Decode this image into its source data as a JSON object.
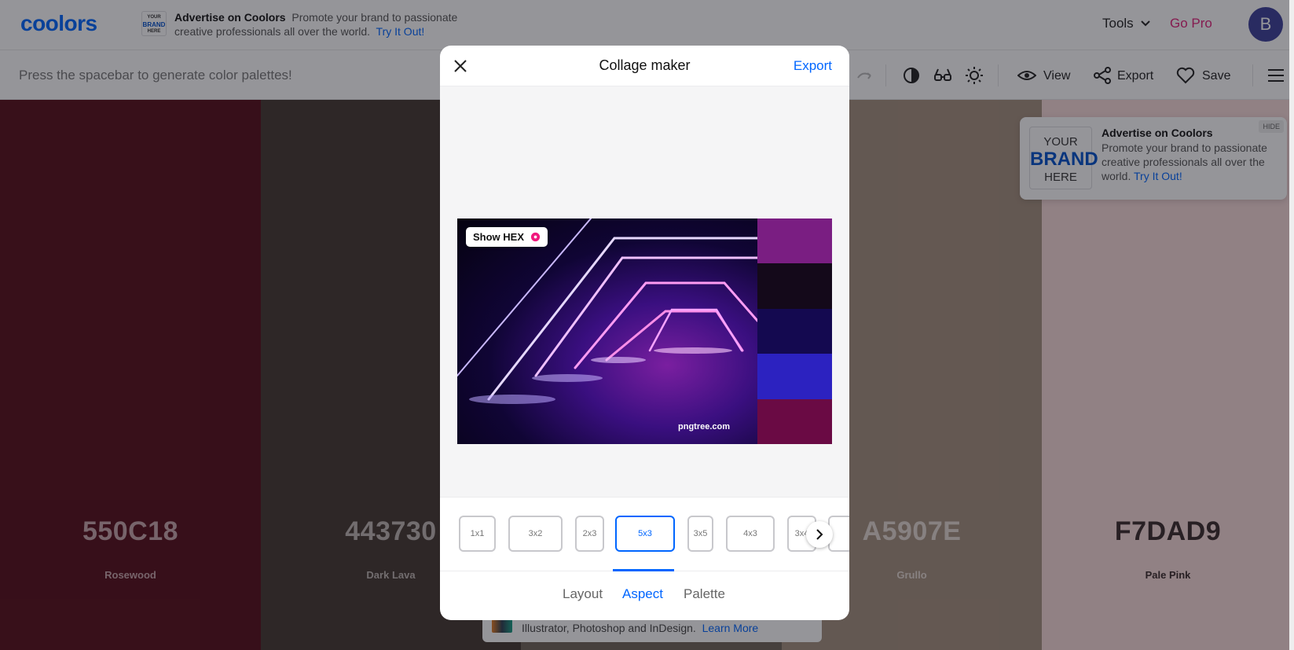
{
  "topbar": {
    "logo": "coolors",
    "brand_mini_top": "YOUR",
    "brand_mini_mid": "BRAND",
    "brand_mini_bottom": "HERE",
    "ad_title": "Advertise on Coolors",
    "ad_text": "Promote your brand to passionate creative professionals all over the world.",
    "ad_link": "Try It Out!",
    "tools_label": "Tools",
    "gopro_label": "Go Pro",
    "avatar_initial": "B"
  },
  "toolbar": {
    "hint": "Press the spacebar to generate color palettes!",
    "view_label": "View",
    "export_label": "Export",
    "save_label": "Save"
  },
  "palette": [
    {
      "hex": "550C18",
      "name": "Rosewood",
      "color": "#550C18",
      "text": "#c9a6ab"
    },
    {
      "hex": "443730",
      "name": "Dark Lava",
      "color": "#443730",
      "text": "#c0b7b2"
    },
    {
      "hex": "",
      "name": "",
      "color": "#6f6458",
      "text": "#d0c8c0"
    },
    {
      "hex": "A5907E",
      "name": "Grullo",
      "color": "#A5907E",
      "text": "#e5dbd3"
    },
    {
      "hex": "F7DAD9",
      "name": "Pale Pink",
      "color": "#F7DAD9",
      "text": "#3a2a2a"
    }
  ],
  "side_ad": {
    "brand_top": "YOUR",
    "brand_mid": "BRAND",
    "brand_bottom": "HERE",
    "title": "Advertise on Coolors",
    "text": "Promote your brand to passionate creative professionals all over the world.",
    "link": "Try It Out!",
    "hide_label": "HIDE"
  },
  "bottom_ad": {
    "text": "Illustrator, Photoshop and InDesign.",
    "link": "Learn More"
  },
  "modal": {
    "title": "Collage maker",
    "export_label": "Export",
    "show_hex_label": "Show HEX",
    "watermark": "pngtree.com",
    "collage_swatches": [
      "#7a1e82",
      "#14091a",
      "#140950",
      "#2c22c0",
      "#6a0a44"
    ],
    "ratios": [
      {
        "label": "1x1",
        "selected": false
      },
      {
        "label": "3x2",
        "selected": false
      },
      {
        "label": "2x3",
        "selected": false
      },
      {
        "label": "5x3",
        "selected": true
      },
      {
        "label": "3x5",
        "selected": false
      },
      {
        "label": "4x3",
        "selected": false
      },
      {
        "label": "3x4",
        "selected": false
      },
      {
        "label": "",
        "selected": false
      }
    ],
    "tabs": [
      {
        "label": "Layout",
        "active": false
      },
      {
        "label": "Aspect",
        "active": true
      },
      {
        "label": "Palette",
        "active": false
      }
    ]
  },
  "colors": {
    "accent": "#0066ff",
    "pro": "#e2227a"
  }
}
